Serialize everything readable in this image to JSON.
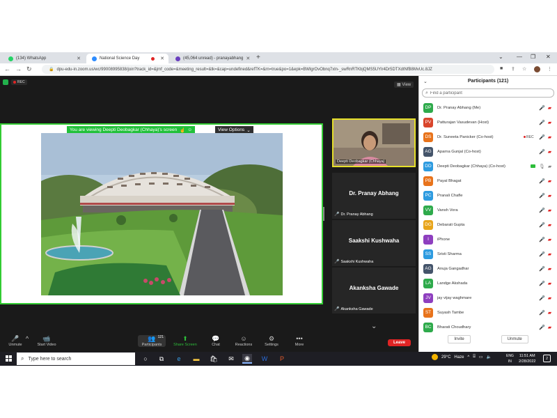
{
  "browser": {
    "tabs": [
      {
        "label": "(134) WhatsApp",
        "icon": "whatsapp-icon",
        "color": "#25d366"
      },
      {
        "label": "National Science Day",
        "icon": "zoom-icon",
        "color": "#2d8cff"
      },
      {
        "label": "(45,064 unread) - pranayabhang",
        "icon": "mail-icon",
        "color": "#6a3fbf"
      }
    ],
    "url": "dpu-edu-in.zoom.us/wc/99008995838/join?track_id=&jmf_code=&meeting_result=&tk=&cap=undefined&refTK=&rn=true&po=1&epk=BWlgrOvObnq7xln-_swRnRTKbjQMS5UYlr4Dr5DTXdtNfB8MvUc.8JZ"
  },
  "meeting": {
    "rec_label": "REC",
    "view_label": "View",
    "viewing_text": "You are viewing Deepti Deobagkar (Chhaya)'s screen",
    "view_options_label": "View Options"
  },
  "tiles": [
    {
      "big": "",
      "small": "Deepti Deobagkar (Chhaya)"
    },
    {
      "big": "Dr. Pranay Abhang",
      "small": "Dr. Pranay Abhang"
    },
    {
      "big": "Saakshi Kushwaha",
      "small": "Saakshi Kushwaha"
    },
    {
      "big": "Akanksha Gawade",
      "small": "Akanksha Gawade"
    }
  ],
  "participants_panel": {
    "title": "Participants (121)",
    "search_placeholder": "Find a participant",
    "invite_label": "Invite",
    "unmute_label": "Unmute",
    "list": [
      {
        "initials": "DP",
        "name": "Dr. Pranay Abhang (Me)",
        "color": "#2eaa4b"
      },
      {
        "initials": "PV",
        "name": "Patturajan Vasudevan (Host)",
        "color": "#d9452b"
      },
      {
        "initials": "DS",
        "name": "Dr. Suneeta Panicker (Co-host)",
        "color": "#e8731b",
        "badge": "REC"
      },
      {
        "initials": "AG",
        "name": "Aparna Gunjal (Co-host)",
        "color": "#44546a"
      },
      {
        "initials": "DD",
        "name": "Deepti Deobagkar (Chhaya) (Co-host)",
        "color": "#2d9be0"
      },
      {
        "initials": "PB",
        "name": "Payal Bhagat",
        "color": "#e8731b"
      },
      {
        "initials": "PC",
        "name": "Pranali Chafle",
        "color": "#2d9be0"
      },
      {
        "initials": "VV",
        "name": "Vansh Vora",
        "color": "#2eaa4b"
      },
      {
        "initials": "DG",
        "name": "Debarati Gupta",
        "color": "#e8a51b"
      },
      {
        "initials": "I",
        "name": "iPhone",
        "color": "#8e3fbf"
      },
      {
        "initials": "SS",
        "name": "Sristi Sharma",
        "color": "#2d9be0"
      },
      {
        "initials": "AG",
        "name": "Anuja Gangadhar",
        "color": "#44546a"
      },
      {
        "initials": "LA",
        "name": "Landge Akshada",
        "color": "#2eaa4b"
      },
      {
        "initials": "JV",
        "name": "jay vijay waghmare",
        "color": "#8e3fbf"
      },
      {
        "initials": "ST",
        "name": "Suyash Tambe",
        "color": "#e8731b"
      },
      {
        "initials": "BC",
        "name": "Bharati Choudhary",
        "color": "#2eaa4b"
      }
    ]
  },
  "toolbar": {
    "unmute": "Unmute",
    "start_video": "Start Video",
    "participants": "Participants",
    "participants_count": "121",
    "share_screen": "Share Screen",
    "chat": "Chat",
    "reactions": "Reactions",
    "settings": "Settings",
    "more": "More",
    "leave": "Leave"
  },
  "taskbar": {
    "search_placeholder": "Type here to search",
    "weather_temp": "29°C",
    "weather_text": "Haze",
    "lang_top": "ENG",
    "lang_bottom": "IN",
    "time": "11:51 AM",
    "date": "2/28/2022",
    "notifications": "2"
  }
}
